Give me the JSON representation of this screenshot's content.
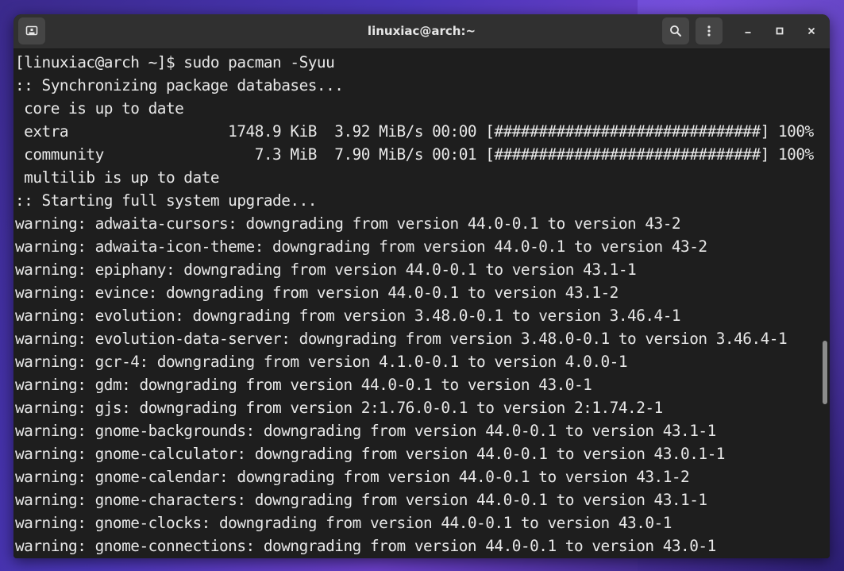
{
  "window": {
    "title": "linuxiac@arch:~"
  },
  "headerbar": {
    "new_tab_icon": "new-tab-icon",
    "search_icon": "search-icon",
    "menu_icon": "kebab-menu-icon",
    "minimize_icon": "minimize-icon",
    "maximize_icon": "maximize-icon",
    "close_icon": "close-icon"
  },
  "colors": {
    "terminal_bg": "#1e1e1e",
    "terminal_fg": "#e8e8e8",
    "headerbar_bg": "#303030",
    "button_bg": "#454545"
  },
  "terminal": {
    "lines": [
      "[linuxiac@arch ~]$ sudo pacman -Syuu",
      ":: Synchronizing package databases...",
      " core is up to date",
      " extra                  1748.9 KiB  3.92 MiB/s 00:00 [##############################] 100%",
      " community                 7.3 MiB  7.90 MiB/s 00:01 [##############################] 100%",
      " multilib is up to date",
      ":: Starting full system upgrade...",
      "warning: adwaita-cursors: downgrading from version 44.0-0.1 to version 43-2",
      "warning: adwaita-icon-theme: downgrading from version 44.0-0.1 to version 43-2",
      "warning: epiphany: downgrading from version 44.0-0.1 to version 43.1-1",
      "warning: evince: downgrading from version 44.0-0.1 to version 43.1-2",
      "warning: evolution: downgrading from version 3.48.0-0.1 to version 3.46.4-1",
      "warning: evolution-data-server: downgrading from version 3.48.0-0.1 to version 3.46.4-1",
      "warning: gcr-4: downgrading from version 4.1.0-0.1 to version 4.0.0-1",
      "warning: gdm: downgrading from version 44.0-0.1 to version 43.0-1",
      "warning: gjs: downgrading from version 2:1.76.0-0.1 to version 2:1.74.2-1",
      "warning: gnome-backgrounds: downgrading from version 44.0-0.1 to version 43.1-1",
      "warning: gnome-calculator: downgrading from version 44.0-0.1 to version 43.0.1-1",
      "warning: gnome-calendar: downgrading from version 44.0-0.1 to version 43.1-2",
      "warning: gnome-characters: downgrading from version 44.0-0.1 to version 43.1-1",
      "warning: gnome-clocks: downgrading from version 44.0-0.1 to version 43.0-1",
      "warning: gnome-connections: downgrading from version 44.0-0.1 to version 43.0-1"
    ]
  }
}
